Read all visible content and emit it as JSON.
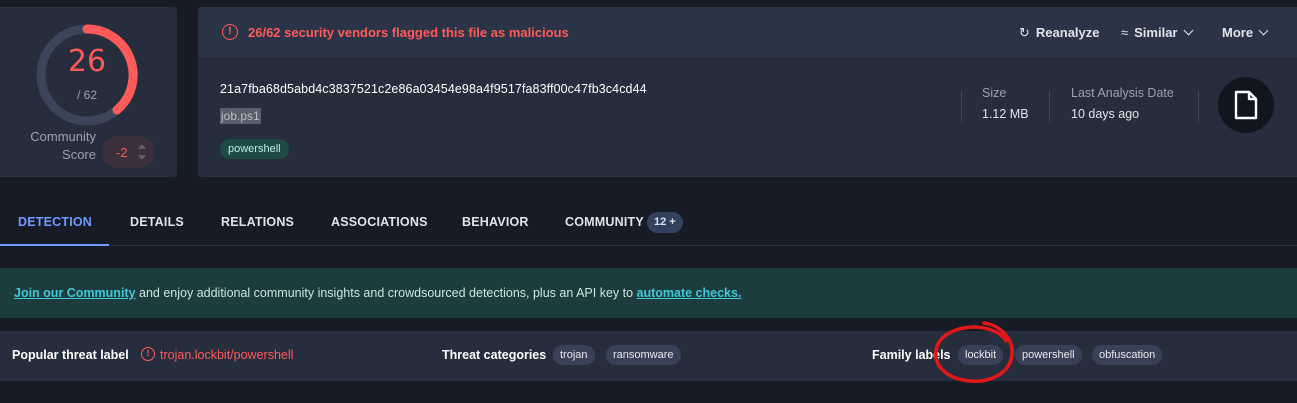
{
  "score": {
    "detections": "26",
    "total": "/ 62",
    "community_label": "Community Score",
    "community_value": "-2"
  },
  "alert": {
    "text": "26/62 security vendors flagged this file as malicious"
  },
  "actions": {
    "reanalyze": "Reanalyze",
    "similar": "Similar",
    "more": "More"
  },
  "file": {
    "hash": "21a7fba68d5abd4c3837521c2e86a03454e98a4f9517fa83ff00c47fb3c4cd44",
    "name": "job.ps1",
    "tag": "powershell",
    "size_label": "Size",
    "size_value": "1.12 MB",
    "date_label": "Last Analysis Date",
    "date_value": "10 days ago"
  },
  "tabs": [
    "DETECTION",
    "DETAILS",
    "RELATIONS",
    "ASSOCIATIONS",
    "BEHAVIOR",
    "COMMUNITY"
  ],
  "community_badge": "12 +",
  "banner": {
    "link1": "Join our Community",
    "middle": " and enjoy additional community insights and crowdsourced detections, plus an API key to ",
    "link2": "automate checks."
  },
  "threat": {
    "popular_label": "Popular threat label",
    "popular_value": "trojan.lockbit/powershell",
    "categories_label": "Threat categories",
    "categories": [
      "trojan",
      "ransomware"
    ],
    "family_label": "Family labels",
    "families": [
      "lockbit",
      "powershell",
      "obfuscation"
    ]
  },
  "colors": {
    "accent": "#6f9cff",
    "malicious": "#ff5a5a",
    "annotation": "#e01818"
  }
}
